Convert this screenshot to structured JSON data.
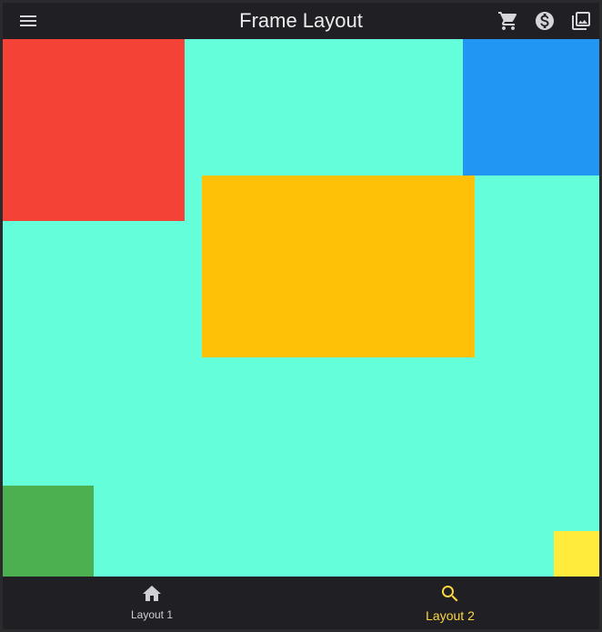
{
  "app_bar": {
    "title": "Frame Layout",
    "icons": [
      "menu-icon",
      "shopping-cart-icon",
      "dollar-coin-icon",
      "photo-library-icon"
    ]
  },
  "canvas": {
    "background": "#64ffda",
    "blocks": [
      {
        "name": "red-block",
        "color": "#f44336"
      },
      {
        "name": "blue-block",
        "color": "#2196f3"
      },
      {
        "name": "amber-block",
        "color": "#ffc107"
      },
      {
        "name": "green-block",
        "color": "#4caf50"
      },
      {
        "name": "yellow-block",
        "color": "#ffeb3b"
      }
    ]
  },
  "bottom_nav": {
    "items": [
      {
        "label": "Layout 1",
        "icon": "home-icon",
        "selected": false
      },
      {
        "label": "Layout 2",
        "icon": "search-icon",
        "selected": true
      }
    ],
    "selected_color": "#ffd740",
    "unselected_color": "#cfcfd4"
  }
}
